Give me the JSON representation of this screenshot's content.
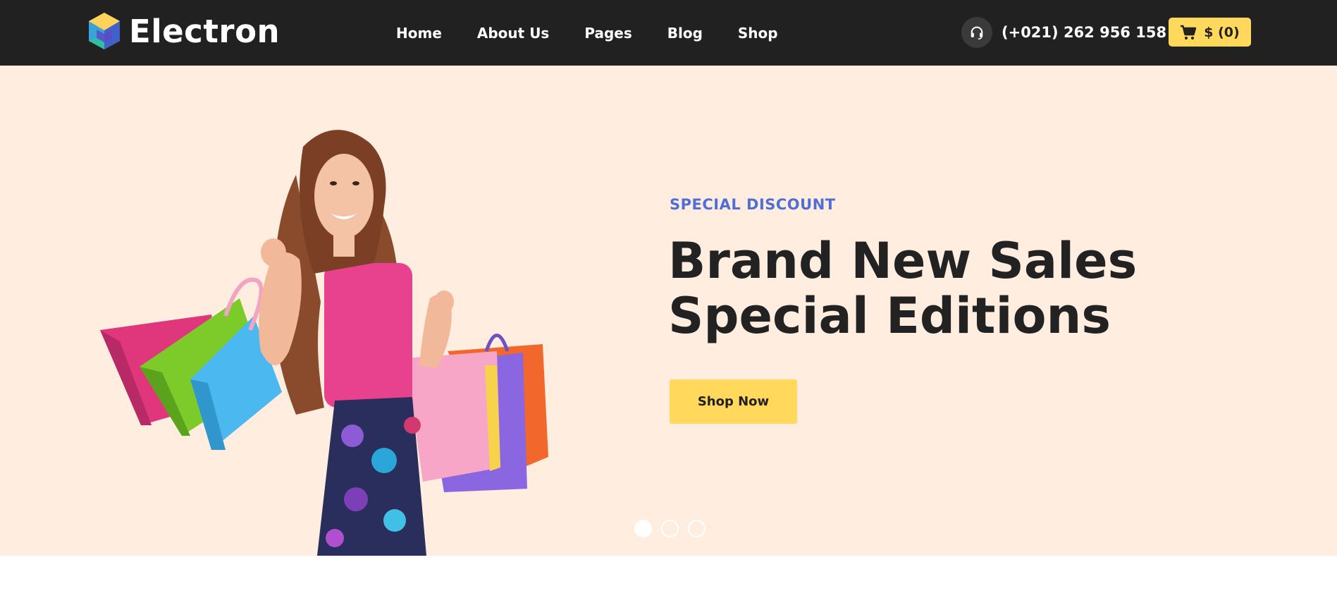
{
  "brand": {
    "name": "Electron"
  },
  "nav": {
    "items": [
      {
        "label": "Home"
      },
      {
        "label": "About Us"
      },
      {
        "label": "Pages"
      },
      {
        "label": "Blog"
      },
      {
        "label": "Shop"
      }
    ]
  },
  "contact": {
    "phone": "(+021) 262 956 158",
    "icon": "headset-icon"
  },
  "cart": {
    "label": "$ (0)",
    "icon": "cart-icon"
  },
  "hero": {
    "eyebrow": "SPECIAL DISCOUNT",
    "title_line1": "Brand New Sales",
    "title_line2": "Special Editions",
    "cta_label": "Shop Now",
    "image": "woman-with-shopping-bags",
    "slides_total": 3,
    "active_slide": 1
  },
  "colors": {
    "header_bg": "#212121",
    "hero_bg": "#ffeddf",
    "accent_yellow": "#ffd85c",
    "eyebrow_blue": "#4f6fd6",
    "title_dark": "#222222"
  }
}
